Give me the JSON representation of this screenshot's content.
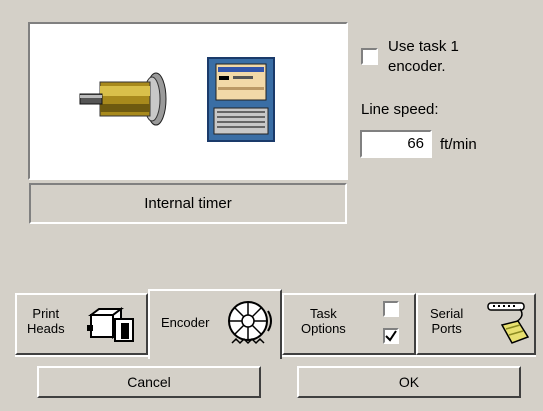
{
  "preview": {
    "mode_label": "Internal timer"
  },
  "encoder_option": {
    "label_line1": "Use task 1",
    "label_line2": "encoder.",
    "checked": false
  },
  "line_speed": {
    "caption": "Line speed:",
    "value": "66",
    "unit": "ft/min"
  },
  "tabs": [
    {
      "line1": "Print",
      "line2": "Heads",
      "icon": "print-heads-icon",
      "selected": false
    },
    {
      "line1": "Encoder",
      "icon": "encoder-wheel-icon",
      "selected": true
    },
    {
      "line1": "Task",
      "line2": "Options",
      "icon": "checkbox-options-icon",
      "selected": false
    },
    {
      "line1": "Serial",
      "line2": "Ports",
      "icon": "serial-cable-icon",
      "selected": false
    }
  ],
  "buttons": {
    "cancel": "Cancel",
    "ok": "OK"
  }
}
